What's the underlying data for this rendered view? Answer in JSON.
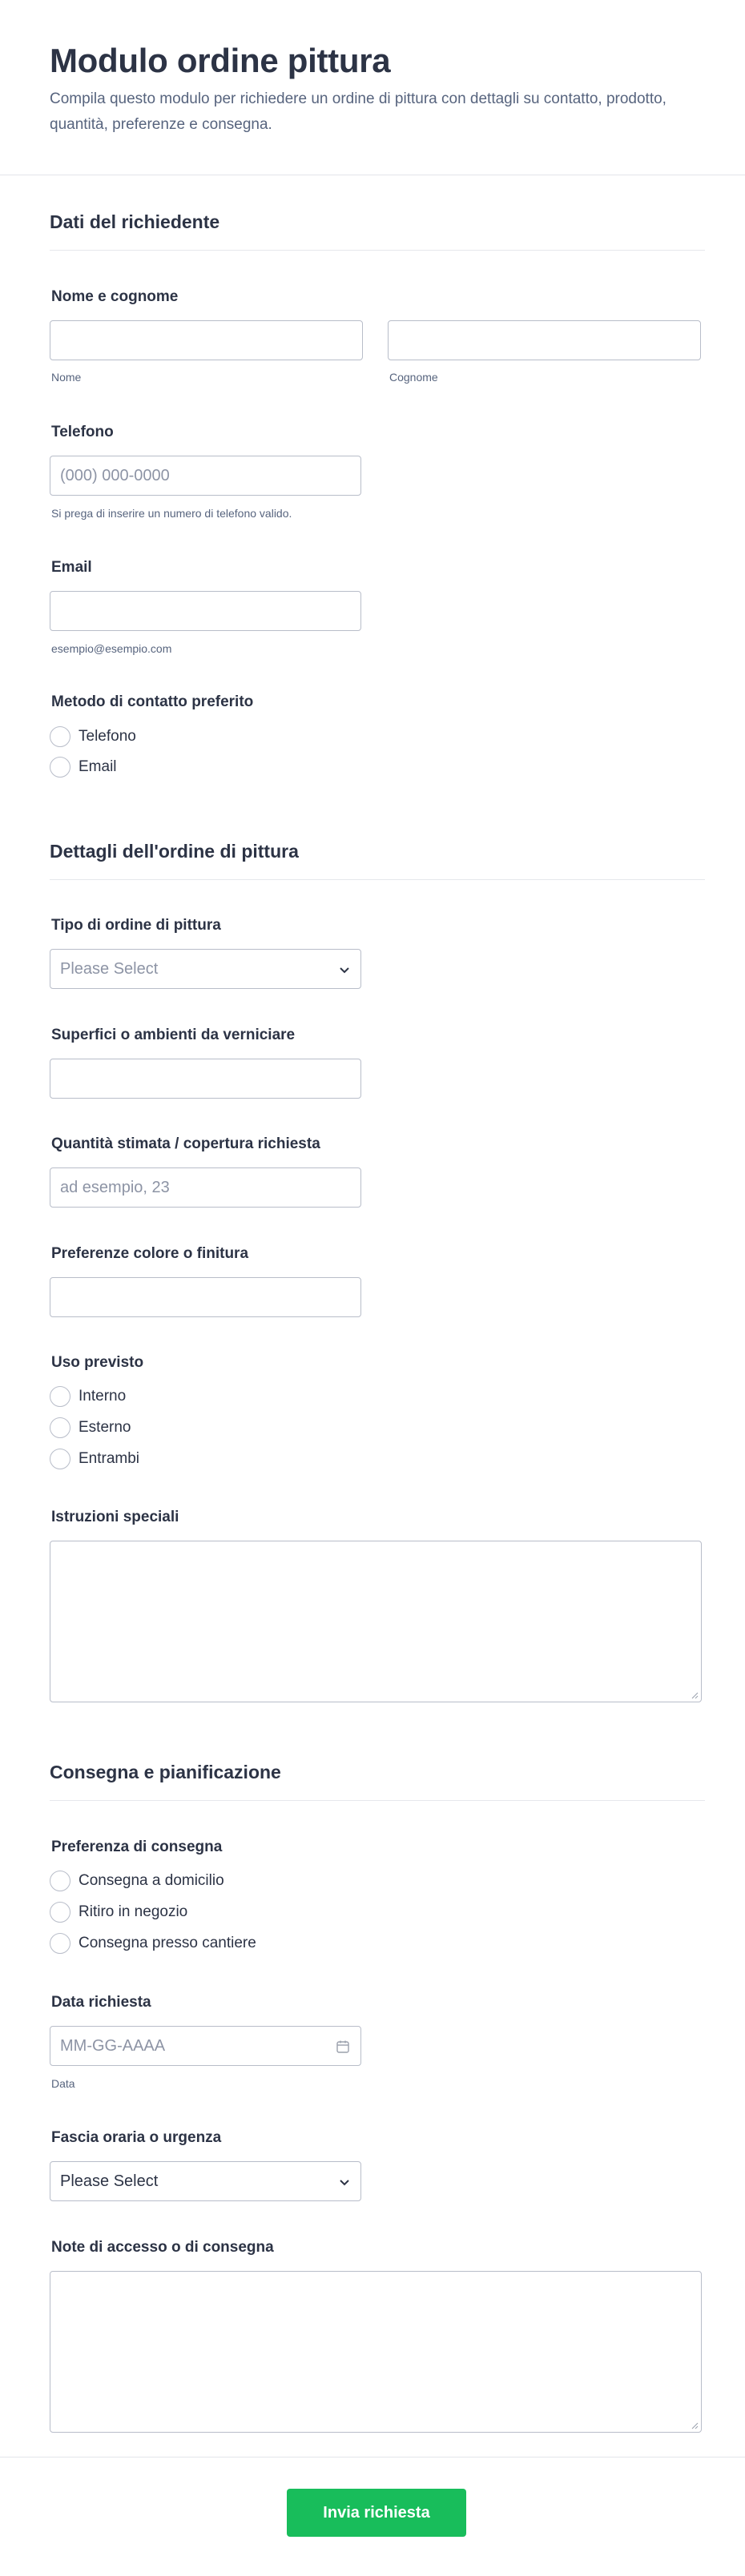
{
  "header": {
    "title": "Modulo ordine pittura",
    "subtitle": "Compila questo modulo per richiedere un ordine di pittura con dettagli su contatto, prodotto, quantità, preferenze e consegna."
  },
  "section1": {
    "title": "Dati del richiedente",
    "name_label": "Nome e cognome",
    "first_sublabel": "Nome",
    "last_sublabel": "Cognome",
    "phone_label": "Telefono",
    "phone_placeholder": "(000) 000-0000",
    "phone_hint": "Si prega di inserire un numero di telefono valido.",
    "email_label": "Email",
    "email_hint": "esempio@esempio.com",
    "contact_label": "Metodo di contatto preferito",
    "contact_options": [
      "Telefono",
      "Email"
    ]
  },
  "section2": {
    "title": "Dettagli dell'ordine di pittura",
    "type_label": "Tipo di ordine di pittura",
    "type_value": "Please Select",
    "surfaces_label": "Superfici o ambienti da verniciare",
    "quantity_label": "Quantità stimata / copertura richiesta",
    "quantity_placeholder": "ad esempio, 23",
    "color_label": "Preferenze colore o finitura",
    "use_label": "Uso previsto",
    "use_options": [
      "Interno",
      "Esterno",
      "Entrambi"
    ],
    "instructions_label": "Istruzioni speciali"
  },
  "section3": {
    "title": "Consegna e pianificazione",
    "delivery_label": "Preferenza di consegna",
    "delivery_options": [
      "Consegna a domicilio",
      "Ritiro in negozio",
      "Consegna presso cantiere"
    ],
    "date_label": "Data richiesta",
    "date_placeholder": "MM-GG-AAAA",
    "date_sublabel": "Data",
    "slot_label": "Fascia oraria o urgenza",
    "slot_value": "Please Select",
    "notes_label": "Note di accesso o di consegna"
  },
  "footer": {
    "submit_label": "Invia richiesta"
  },
  "colors": {
    "accent": "#18bd5b",
    "text": "#2c3345",
    "border": "#b8bdc9"
  }
}
